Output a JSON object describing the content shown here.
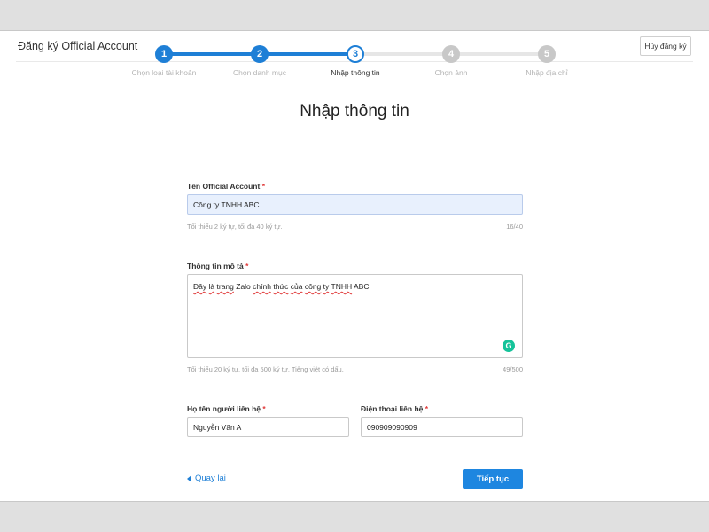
{
  "header": {
    "title": "Đăng ký Official Account",
    "cancel_label": "Hủy đăng ký"
  },
  "stepper": {
    "steps": [
      {
        "number": "1",
        "label": "Chọn loại tài khoản",
        "state": "done"
      },
      {
        "number": "2",
        "label": "Chọn danh mục",
        "state": "done"
      },
      {
        "number": "3",
        "label": "Nhập thông tin",
        "state": "current"
      },
      {
        "number": "4",
        "label": "Chọn ảnh",
        "state": "todo"
      },
      {
        "number": "5",
        "label": "Nhập địa chỉ",
        "state": "todo"
      }
    ]
  },
  "form": {
    "title": "Nhập thông tin",
    "oa_name": {
      "label": "Tên Official Account",
      "required_mark": "*",
      "value": "Công ty TNHH ABC",
      "hint": "Tối thiểu 2 ký tự, tối đa 40 ký tự.",
      "counter": "16/40"
    },
    "description": {
      "label": "Thông tin mô tả",
      "required_mark": "*",
      "value_parts": [
        "Đây",
        " ",
        "là",
        " ",
        "trang",
        " ",
        "Zalo",
        " ",
        "chính",
        " ",
        "thức",
        " ",
        "của",
        " ",
        "công",
        " ",
        "ty",
        " ",
        "TNHH",
        " ABC"
      ],
      "hint": "Tối thiểu 20 ký tự, tối đa 500 ký tự. Tiếng việt có dấu.",
      "counter": "49/500"
    },
    "contact_name": {
      "label": "Họ tên người liên hệ",
      "required_mark": "*",
      "value": "Nguyễn Văn A"
    },
    "contact_phone": {
      "label": "Điện thoại liên hệ",
      "required_mark": "*",
      "value": "090909090909"
    }
  },
  "footer": {
    "back_label": "Quay lại",
    "continue_label": "Tiếp tục"
  },
  "colors": {
    "accent": "#1e7fd6",
    "inactive": "#c8c8c8",
    "required": "#e03a3a",
    "grammarly": "#15c39a"
  },
  "icons": {
    "back": "triangle-left",
    "grammarly": "G"
  }
}
